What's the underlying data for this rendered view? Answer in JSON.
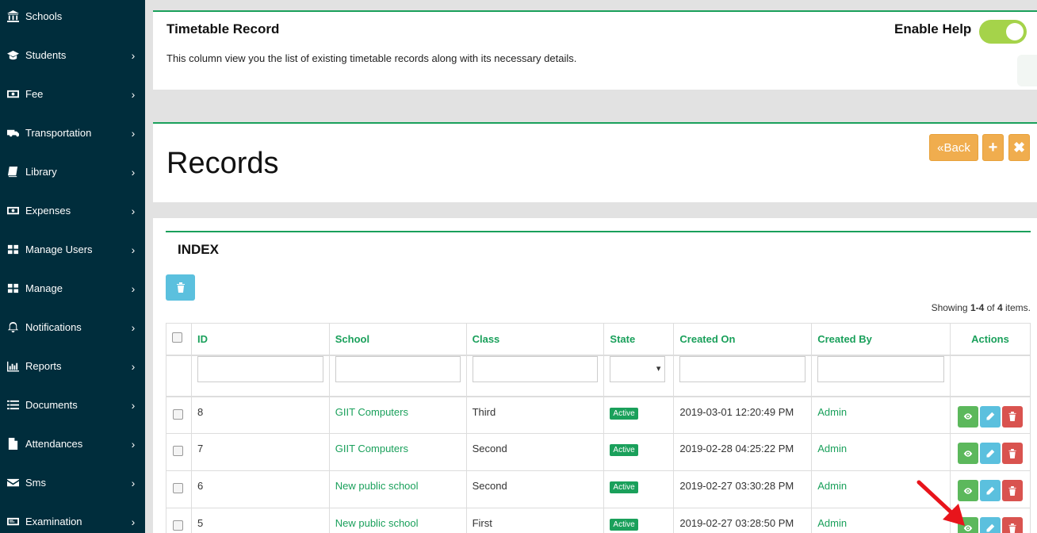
{
  "sidebar": {
    "items": [
      {
        "label": "Schools",
        "icon": "bank-icon",
        "chevron": false
      },
      {
        "label": "Students",
        "icon": "graduation-cap-icon",
        "chevron": true
      },
      {
        "label": "Fee",
        "icon": "money-icon",
        "chevron": true
      },
      {
        "label": "Transportation",
        "icon": "truck-icon",
        "chevron": true
      },
      {
        "label": "Library",
        "icon": "book-icon",
        "chevron": true
      },
      {
        "label": "Expenses",
        "icon": "money-icon",
        "chevron": true
      },
      {
        "label": "Manage Users",
        "icon": "grid-icon",
        "chevron": true
      },
      {
        "label": "Manage",
        "icon": "grid-icon",
        "chevron": true
      },
      {
        "label": "Notifications",
        "icon": "bell-icon",
        "chevron": true
      },
      {
        "label": "Reports",
        "icon": "bar-chart-icon",
        "chevron": true
      },
      {
        "label": "Documents",
        "icon": "list-icon",
        "chevron": true
      },
      {
        "label": "Attendances",
        "icon": "file-icon",
        "chevron": true
      },
      {
        "label": "Sms",
        "icon": "envelope-icon",
        "chevron": true
      },
      {
        "label": "Examination",
        "icon": "card-icon",
        "chevron": true
      }
    ],
    "chevron_glyph": "›"
  },
  "help": {
    "title": "Timetable Record",
    "text": "This column view you the list of existing timetable records along with its necessary details.",
    "enable_label": "Enable Help",
    "enabled": true
  },
  "records": {
    "title": "Records",
    "back_label": "Back",
    "back_icon": "«",
    "plus_glyph": "+",
    "close_glyph": "✖"
  },
  "index": {
    "title": "INDEX",
    "summary_prefix": "Showing ",
    "summary_range": "1-4",
    "summary_of": " of ",
    "summary_total": "4",
    "summary_suffix": " items.",
    "columns": [
      "ID",
      "School",
      "Class",
      "State",
      "Created On",
      "Created By",
      "Actions"
    ],
    "rows": [
      {
        "id": "8",
        "school": "GIIT Computers",
        "class": "Third",
        "state": "Active",
        "created_on": "2019-03-01 12:20:49 PM",
        "created_by": "Admin"
      },
      {
        "id": "7",
        "school": "GIIT Computers",
        "class": "Second",
        "state": "Active",
        "created_on": "2019-02-28 04:25:22 PM",
        "created_by": "Admin"
      },
      {
        "id": "6",
        "school": "New public school",
        "class": "Second",
        "state": "Active",
        "created_on": "2019-02-27 03:30:28 PM",
        "created_by": "Admin"
      },
      {
        "id": "5",
        "school": "New public school",
        "class": "First",
        "state": "Active",
        "created_on": "2019-02-27 03:28:50 PM",
        "created_by": "Admin"
      }
    ]
  },
  "colors": {
    "sidebar_bg": "#002d3c",
    "accent_green": "#1aa05b",
    "toggle_green": "#a5d34a",
    "warning_orange": "#f0ad4e",
    "info_blue": "#5bc0de",
    "success_green": "#5cb85c",
    "danger_red": "#d9534f",
    "annotation_red": "#e8141b"
  }
}
